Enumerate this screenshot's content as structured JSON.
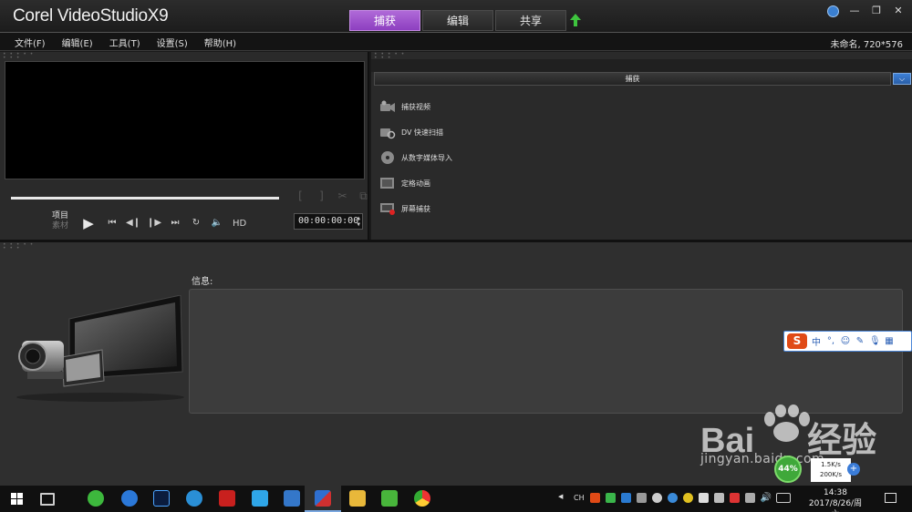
{
  "app": {
    "title": "Corel VideoStudioX9",
    "tabs": [
      {
        "label": "捕获",
        "active": true
      },
      {
        "label": "编辑",
        "active": false
      },
      {
        "label": "共享",
        "active": false
      }
    ],
    "accent_color": "#9b4fd1"
  },
  "menu": {
    "items": [
      "文件(F)",
      "编辑(E)",
      "工具(T)",
      "设置(S)",
      "帮助(H)"
    ],
    "project_info": "未命名, 720*576"
  },
  "player": {
    "mode_project": "项目",
    "mode_clip": "素材",
    "hd_label": "HD",
    "timecode": "00:00:00:00"
  },
  "capture": {
    "header": "捕获",
    "options": [
      {
        "label": "捕获视频",
        "icon": "video-capture-icon"
      },
      {
        "label": "DV 快速扫描",
        "icon": "dv-scan-icon"
      },
      {
        "label": "从数字媒体导入",
        "icon": "digital-import-icon"
      },
      {
        "label": "定格动画",
        "icon": "stop-motion-icon"
      },
      {
        "label": "屏幕捕获",
        "icon": "screen-capture-icon"
      }
    ]
  },
  "info": {
    "label": "信息:"
  },
  "watermark": {
    "brand": "Bai",
    "brand2": "经验",
    "url": "jingyan.baidu.com"
  },
  "ime": {
    "lang": "中"
  },
  "network": {
    "percent": "44%",
    "up": "1.5K/s",
    "down": "200K/s"
  },
  "taskbar": {
    "lang": "CH",
    "time": "14:38",
    "date": "2017/8/26/周六"
  }
}
